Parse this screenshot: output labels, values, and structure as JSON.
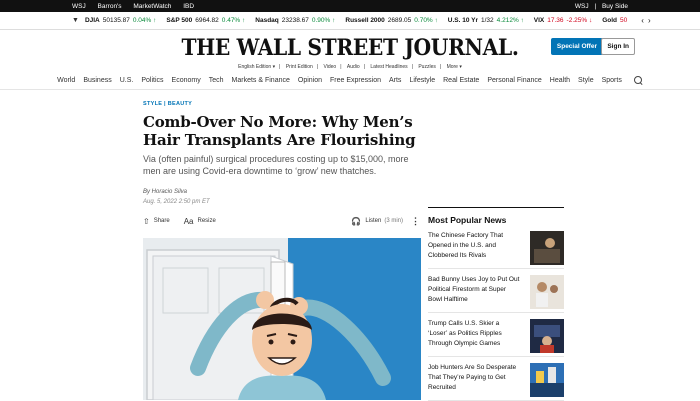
{
  "topbar": {
    "left": [
      "WSJ",
      "Barron's",
      "MarketWatch",
      "IBD"
    ],
    "right": [
      "WSJ",
      "|",
      "Buy Side"
    ]
  },
  "ticker": [
    {
      "sym": "DJIA",
      "val": "50135.87",
      "chg": "0.04%",
      "dir": "up"
    },
    {
      "sym": "S&P 500",
      "val": "6964.82",
      "chg": "0.47%",
      "dir": "up"
    },
    {
      "sym": "Nasdaq",
      "val": "23238.67",
      "chg": "0.90%",
      "dir": "up"
    },
    {
      "sym": "Russell 2000",
      "val": "2689.05",
      "chg": "0.70%",
      "dir": "up"
    },
    {
      "sym": "U.S. 10 Yr",
      "val": "1/32",
      "chg": "4.212%",
      "dir": "up"
    },
    {
      "sym": "VIX",
      "val": "17.36",
      "chg": "-2.25%",
      "dir": "down"
    },
    {
      "sym": "Gold",
      "val": "50",
      "chg": "",
      "dir": "down"
    }
  ],
  "masthead": {
    "logo": "THE WALL STREET JOURNAL.",
    "edition": [
      "English Edition ▾",
      "Print Edition",
      "Video",
      "Audio",
      "Latest Headlines",
      "Puzzles",
      "More ▾"
    ],
    "offer_label": "Special Offer",
    "signin_label": "Sign In"
  },
  "nav": [
    "World",
    "Business",
    "U.S.",
    "Politics",
    "Economy",
    "Tech",
    "Markets & Finance",
    "Opinion",
    "Free Expression",
    "Arts",
    "Lifestyle",
    "Real Estate",
    "Personal Finance",
    "Health",
    "Style",
    "Sports"
  ],
  "article": {
    "kicker": "STYLE  |  BEAUTY",
    "headline": "Comb-Over No More: Why Men’s Hair Transplants Are Flourishing",
    "dek": "Via (often painful) surgical procedures costing up to $15,000, more men are using Covid-era downtime to ‘grow’ new thatches.",
    "byline": "By Horacio Silva",
    "date": "Aug. 5, 2022 2:50 pm ET",
    "share_label": "Share",
    "resize_label": "Resize",
    "listen_label": "Listen",
    "listen_length": "(3 min)"
  },
  "popular": {
    "title": "Most Popular News",
    "items": [
      {
        "title": "The Chinese Factory That Opened in the U.S. and Clobbered Its Rivals"
      },
      {
        "title": "Bad Bunny Uses Joy to Put Out Political Firestorm at Super Bowl Halftime"
      },
      {
        "title": "Trump Calls U.S. Skier a ‘Loser’ as Politics Ripples Through Olympic Games"
      },
      {
        "title": "Job Hunters Are So Desperate That They’re Paying to Get Recruited"
      }
    ]
  },
  "colors": {
    "accent": "#0274b6",
    "up": "#0a8a3b",
    "down": "#d0021b"
  }
}
